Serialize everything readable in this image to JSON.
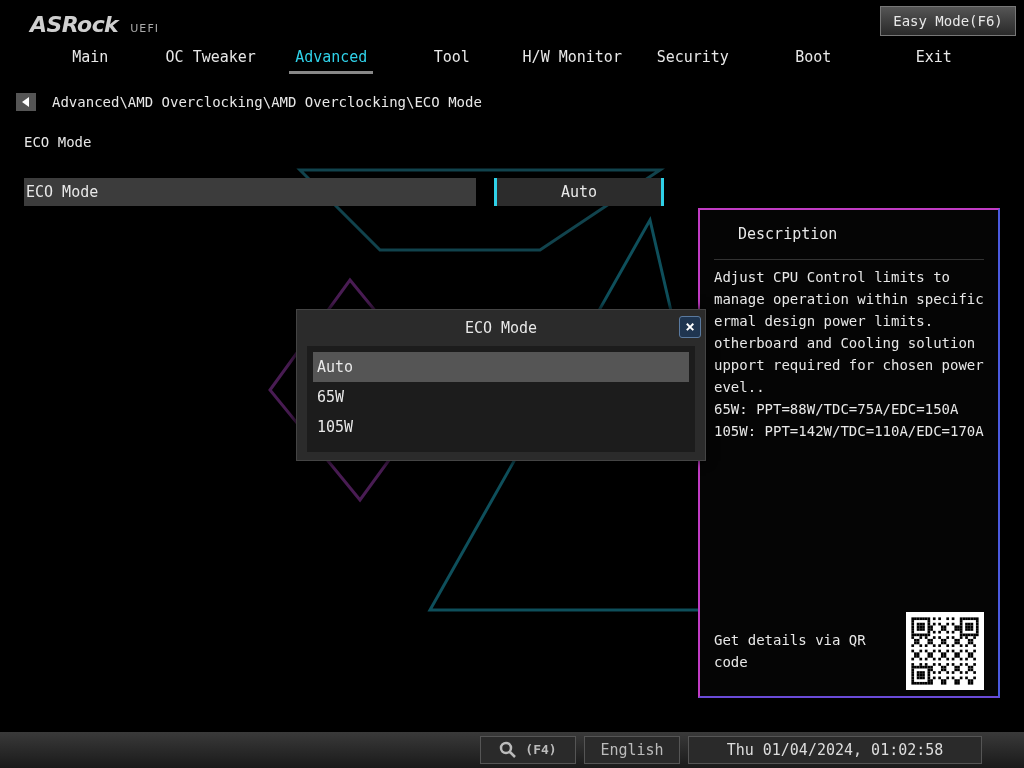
{
  "header": {
    "logo": "ASRock",
    "logo_sub": "UEFI",
    "easy_mode_button": "Easy Mode(F6)"
  },
  "tabs": [
    {
      "label": "Main",
      "selected": false
    },
    {
      "label": "OC Tweaker",
      "selected": false
    },
    {
      "label": "Advanced",
      "selected": true
    },
    {
      "label": "Tool",
      "selected": false
    },
    {
      "label": "H/W Monitor",
      "selected": false
    },
    {
      "label": "Security",
      "selected": false
    },
    {
      "label": "Boot",
      "selected": false
    },
    {
      "label": "Exit",
      "selected": false
    }
  ],
  "breadcrumb": "Advanced\\AMD Overclocking\\AMD Overclocking\\ECO Mode",
  "section_title": "ECO Mode",
  "settings": [
    {
      "label": "ECO Mode",
      "value": "Auto",
      "selected": true
    }
  ],
  "description": {
    "title": "Description",
    "lines": [
      "Adjust CPU Control limits to",
      "manage operation within specific",
      "ermal design power limits.",
      "otherboard and Cooling solution",
      "upport required for chosen power",
      "evel..",
      "65W: PPT=88W/TDC=75A/EDC=150A",
      "105W: PPT=142W/TDC=110A/EDC=170A"
    ],
    "qr_text": "Get details via QR code"
  },
  "popup": {
    "title": "ECO Mode",
    "close": "×",
    "options": [
      {
        "label": "Auto",
        "selected": true
      },
      {
        "label": "65W",
        "selected": false
      },
      {
        "label": "105W",
        "selected": false
      }
    ]
  },
  "status_bar": {
    "search": "(F4)",
    "language": "English",
    "datetime": "Thu 01/04/2024, 01:02:58"
  }
}
